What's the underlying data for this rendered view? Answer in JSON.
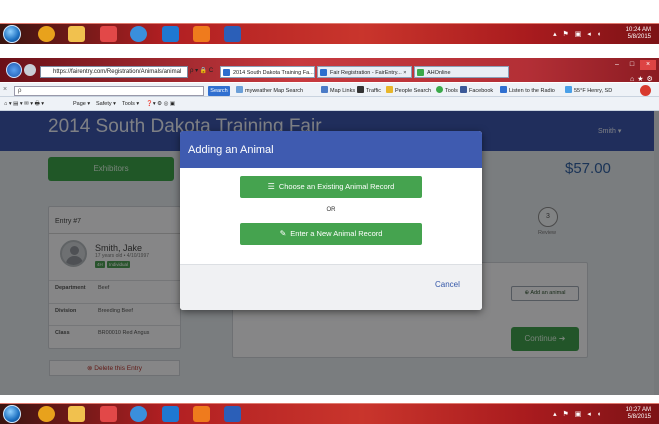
{
  "taskbar_top": {
    "tray_time": "10:24 AM",
    "tray_date": "5/8/2015"
  },
  "taskbar_bottom": {
    "tray_time": "10:27 AM",
    "tray_date": "5/8/2015"
  },
  "browser": {
    "address": "https://fairentry.com/Registration/Animals/animal",
    "address_controls": "ρ ▾ 🔒 C",
    "tabs": [
      {
        "label": "2014 South Dakota Training Fa...",
        "active": true
      },
      {
        "label": "Fair Registration - FairEntry... ×",
        "active": false
      },
      {
        "label": "AHOnline",
        "active": false
      }
    ],
    "search_placeholder": "ρ",
    "search_button": "Search",
    "toolbar_items": [
      "myweather Map Search",
      "Map Links",
      "Traffic",
      "People Search",
      "Tools",
      "Facebook",
      "Listen to the Radio",
      "55°F Henry, SD"
    ],
    "command_items": [
      "Page ▾",
      "Safety ▾",
      "Tools ▾"
    ]
  },
  "site": {
    "title": "2014 South Dakota Training Fair",
    "user_menu": "Smith ▾",
    "exhibitors_label": "Exhibitors",
    "total": "$57.00"
  },
  "entry": {
    "header": "Entry #7",
    "name": "Smith, Jake",
    "age": "17 years old • 4/10/1997",
    "badges": [
      "4H",
      "Individual"
    ],
    "rows": [
      {
        "key": "Department",
        "value": "Beef"
      },
      {
        "key": "Division",
        "value": "Breeding Beef"
      },
      {
        "key": "Class",
        "value": "BR00010 Red Angus"
      }
    ],
    "delete_label": "Delete this Entry"
  },
  "steps": {
    "step_number": "3",
    "step_label": "Review"
  },
  "add_animal_label": "Add an animal",
  "continue_label": "Continue",
  "modal": {
    "title": "Adding an Animal",
    "existing_label": "Choose an Existing Animal Record",
    "or_label": "OR",
    "new_label": "Enter a New Animal Record",
    "cancel_label": "Cancel"
  },
  "colors": {
    "modal_header": "#3f5bb0",
    "action_green": "#45a34f",
    "site_header": "#3b55a8",
    "taskbar_red": "#c9352c"
  }
}
